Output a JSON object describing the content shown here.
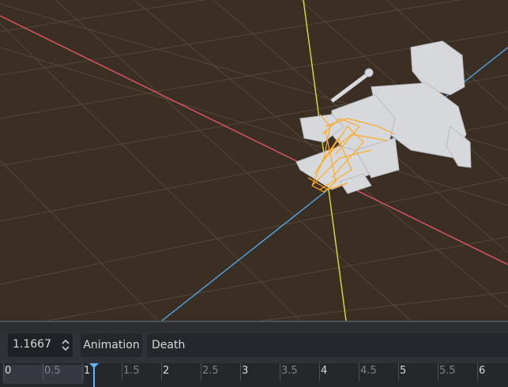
{
  "toolbar": {
    "time_value": "1.1667",
    "animation_label": "Animation",
    "animation_selected": "Death"
  },
  "timeline": {
    "ticks": [
      "0",
      "0.5",
      "1",
      "1.5",
      "2",
      "2.5",
      "3",
      "3.5",
      "4",
      "4.5",
      "5",
      "5.5",
      "6"
    ],
    "playhead_time": 1.1667
  },
  "colors": {
    "viewport_bg": "#3b2e22",
    "grid": "#6e6152",
    "x_axis": "#e05565",
    "y_axis": "#d6e04a",
    "z_axis": "#4ea6e6",
    "skeleton": "#ffaa22",
    "mesh": "#d8dadc",
    "playhead": "#5fb6ff"
  }
}
